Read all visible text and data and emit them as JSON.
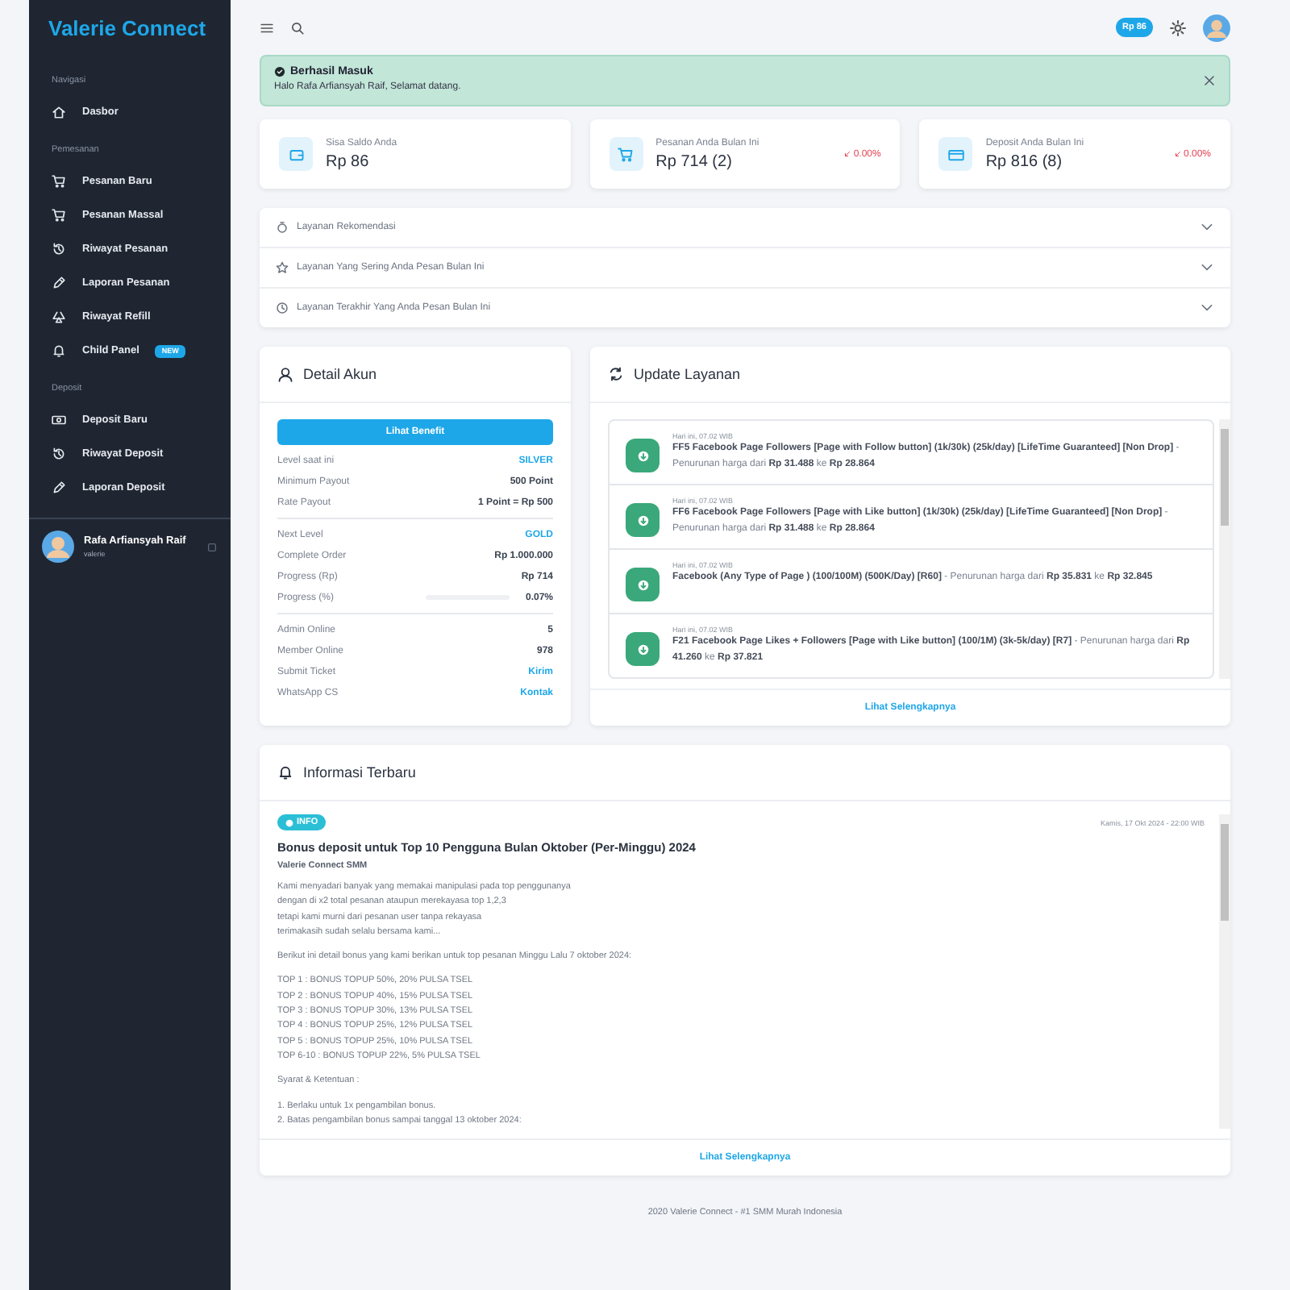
{
  "sidebar": {
    "brand": "Valerie Connect",
    "sections": [
      {
        "title": "Navigasi",
        "items": [
          {
            "label": "Dasbor",
            "selected": false
          }
        ]
      },
      {
        "title": "Pemesanan",
        "items": [
          {
            "label": "Pesanan Baru",
            "selected": false
          },
          {
            "label": "Pesanan Massal",
            "selected": false
          },
          {
            "label": "Riwayat Pesanan",
            "selected": false
          },
          {
            "label": "Laporan Pesanan",
            "selected": false
          },
          {
            "label": "Riwayat Refill",
            "selected": false
          },
          {
            "label": "Child Panel",
            "selected": false,
            "badge": "NEW"
          }
        ]
      },
      {
        "title": "Deposit",
        "items": [
          {
            "label": "Deposit Baru",
            "selected": false
          },
          {
            "label": "Riwayat Deposit",
            "selected": false
          },
          {
            "label": "Laporan Deposit",
            "selected": false
          }
        ]
      }
    ],
    "user": {
      "name": "Rafa Arfiansyah Raif",
      "username": "valerie"
    }
  },
  "topbar": {
    "balance": "Rp 86"
  },
  "alert": {
    "title": "Berhasil Masuk",
    "message": "Halo Rafa Arfiansyah Raif, Selamat datang."
  },
  "stats": [
    {
      "label": "Sisa Saldo Anda",
      "value": "Rp 86"
    },
    {
      "label": "Pesanan Anda Bulan Ini",
      "value": "Rp 714 (2)",
      "change": "0.00%"
    },
    {
      "label": "Deposit Anda Bulan Ini",
      "value": "Rp 816 (8)",
      "change": "0.00%"
    }
  ],
  "accordion": [
    {
      "label": "Layanan Rekomendasi",
      "expanded": false
    },
    {
      "label": "Layanan Yang Sering Anda Pesan Bulan Ini",
      "expanded": false
    },
    {
      "label": "Layanan Terakhir Yang Anda Pesan Bulan Ini",
      "expanded": false
    }
  ],
  "account": {
    "title": "Detail Akun",
    "button": "Lihat Benefit",
    "groups": [
      [
        {
          "label": "Level saat ini",
          "value": "SILVER",
          "kind": "accent"
        },
        {
          "label": "Minimum Payout",
          "value": "500 Point",
          "kind": "plain"
        },
        {
          "label": "Rate Payout",
          "value": "1 Point = Rp 500",
          "kind": "plain"
        }
      ],
      [
        {
          "label": "Next Level",
          "value": "GOLD",
          "kind": "accent"
        },
        {
          "label": "Complete Order",
          "value": "Rp 1.000.000",
          "kind": "plain"
        },
        {
          "label": "Progress (Rp)",
          "value": "Rp 714",
          "kind": "plain"
        },
        {
          "label": "Progress (%)",
          "value": "0.07%",
          "kind": "progress",
          "level": 0.0007
        }
      ],
      [
        {
          "label": "Admin Online",
          "value": "5",
          "kind": "plain"
        },
        {
          "label": "Member Online",
          "value": "978",
          "kind": "plain"
        },
        {
          "label": "Submit Ticket",
          "value": "Kirim",
          "kind": "link"
        },
        {
          "label": "WhatsApp CS",
          "value": "Kontak",
          "kind": "link"
        }
      ]
    ]
  },
  "updates": {
    "title": "Update Layanan",
    "more": "Lihat Selengkapnya",
    "items": [
      {
        "time": "Hari ini, 07.02 WIB",
        "text": "**FF5 Facebook Page Followers [Page with Follow button] (1k/30k) (25k/day) [LifeTime Guaranteed] [Non Drop]** - Penurunan harga dari **Rp 31.488** ke **Rp 28.864**"
      },
      {
        "time": "Hari ini, 07.02 WIB",
        "text": "**FF6 Facebook Page Followers [Page with Like button] (1k/30k) (25k/day) [LifeTime Guaranteed] [Non Drop]** - Penurunan harga dari **Rp 31.488** ke **Rp 28.864**"
      },
      {
        "time": "Hari ini, 07.02 WIB",
        "text": "**Facebook (Any Type of Page ) (100/100M) (500K/Day) [R60]** - Penurunan harga dari **Rp 35.831** ke **Rp 32.845**"
      },
      {
        "time": "Hari ini, 07.02 WIB",
        "text": "**F21 Facebook Page Likes + Followers [Page with Like button] (100/1M) (3k-5k/day) [R7]** - Penurunan harga dari **Rp 41.260** ke **Rp 37.821**"
      }
    ]
  },
  "news": {
    "title": "Informasi Terbaru",
    "more": "Lihat Selengkapnya",
    "badge": "INFO",
    "date": "Kamis, 17 Okt 2024 - 22:00 WIB",
    "headline": "Bonus deposit untuk Top 10 Pengguna Bulan Oktober (Per-Minggu) 2024",
    "author": "Valerie Connect SMM",
    "paragraphs": [
      [
        "Kami menyadari banyak yang memakai manipulasi pada top penggunanya",
        "dengan di x2 total pesanan ataupun merekayasa top 1,2,3",
        "tetapi kami murni dari pesanan user tanpa rekayasa",
        "terimakasih sudah selalu bersama kami..."
      ],
      [
        "Berikut ini detail bonus yang kami berikan untuk top pesanan Minggu Lalu 7 oktober 2024:"
      ],
      [
        "TOP 1 : BONUS TOPUP 50%, 20% PULSA TSEL",
        "TOP 2 : BONUS TOPUP 40%, 15% PULSA TSEL",
        "TOP 3 : BONUS TOPUP 30%, 13% PULSA TSEL",
        "TOP 4 : BONUS TOPUP 25%, 12% PULSA TSEL",
        "TOP 5 : BONUS TOPUP 25%, 10% PULSA TSEL",
        "TOP 6-10 : BONUS TOPUP 22%, 5% PULSA TSEL"
      ],
      [
        "Syarat & Ketentuan :"
      ],
      [
        "1. Berlaku untuk 1x pengambilan bonus.",
        "2. Batas pengambilan bonus sampai tanggal 13 oktober 2024:"
      ]
    ]
  },
  "footer": "2020 Valerie Connect - #1 SMM Murah Indonesia"
}
